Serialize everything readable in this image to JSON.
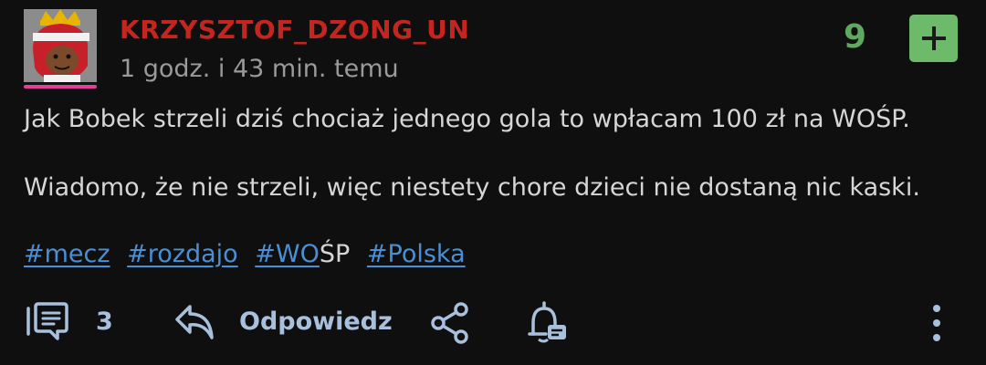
{
  "post": {
    "username": "KRZYSZTOF_DZONG_UN",
    "timestamp": "1 godz. i 43 min. temu",
    "votes": "9",
    "body_line1": "Jak Bobek strzeli dziś chociaż jednego gola to wpłacam 100 zł na WOŚP.",
    "body_line2": "Wiadomo, że nie strzeli, więc niestety chore dzieci nie dostaną nic kaski.",
    "tags": {
      "t1": "#mecz",
      "t2": "#rozdajo",
      "t3_link": "#WO",
      "t3_rest": "ŚP",
      "t4": "#Polska"
    }
  },
  "actions": {
    "comments_count": "3",
    "reply_label": "Odpowiedz"
  },
  "colors": {
    "username": "#c4261f",
    "vote_green": "#6dbb6a",
    "tag_blue": "#4a8fd4",
    "action_text": "#a9c0dc",
    "avatar_underline": "#e0409a"
  },
  "icons": [
    "avatar-image",
    "plus-icon",
    "comments-icon",
    "reply-icon",
    "share-icon",
    "bell-icon",
    "more-vertical-icon"
  ]
}
